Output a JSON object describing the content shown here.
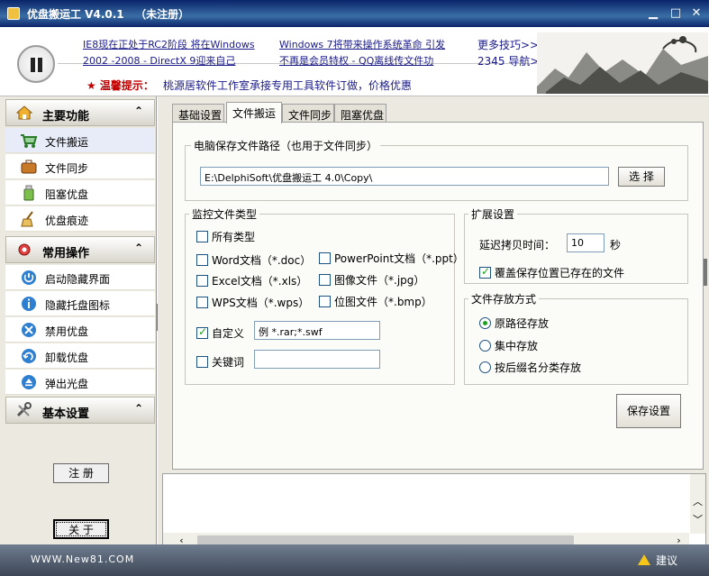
{
  "window": {
    "title": "优盘搬运工 V4.0.1   （未注册）",
    "min_glyph": "▁",
    "restore_glyph": "□",
    "close_glyph": "✕"
  },
  "banner": {
    "news": [
      "IE8现在正处于RC2阶段 将在Windows",
      "2002 -2008 - DirectX 9迎来自己",
      "Windows 7将带来操作系统革命 引发",
      "不再是会员特权 - QQ离线传文件功"
    ],
    "more_tips": "更多技巧>>",
    "nav_2345": "2345 导航>>",
    "tip_label": "★ 温馨提示：",
    "tip_text": "桃源居软件工作室承接专用工具软件订做，价格优惠"
  },
  "sidebar": {
    "sections": [
      {
        "label": "主要功能",
        "chevron": "⌃",
        "icon": "house-icon"
      },
      {
        "label": "常用操作",
        "chevron": "⌃",
        "icon": "gear-icon"
      },
      {
        "label": "基本设置",
        "chevron": "⌃",
        "icon": "tools-icon"
      }
    ],
    "main_items": [
      {
        "label": "文件搬运",
        "icon": "cart-icon"
      },
      {
        "label": "文件同步",
        "icon": "briefcase-icon"
      },
      {
        "label": "阻塞优盘",
        "icon": "usb-drive-icon"
      },
      {
        "label": "优盘痕迹",
        "icon": "broom-icon"
      }
    ],
    "ops_items": [
      {
        "label": "启动隐藏界面",
        "icon": "power-icon"
      },
      {
        "label": "隐藏托盘图标",
        "icon": "info-icon"
      },
      {
        "label": "禁用优盘",
        "icon": "block-icon"
      },
      {
        "label": "卸载优盘",
        "icon": "unload-icon"
      },
      {
        "label": "弹出光盘",
        "icon": "eject-icon"
      }
    ],
    "register_label": "注 册",
    "about_label": "关 于"
  },
  "tabs": [
    "基础设置",
    "文件搬运",
    "文件同步",
    "阻塞优盘"
  ],
  "path_group": {
    "legend": "电脑保存文件路径（也用于文件同步）",
    "path_value": "E:\\DelphiSoft\\优盘搬运工 4.0\\Copy\\",
    "browse_label": "选 择"
  },
  "types_group": {
    "legend": "监控文件类型",
    "all_types": "所有类型",
    "word": "Word文档（*.doc）",
    "excel": "Excel文档（*.xls）",
    "wps": "WPS文档（*.wps）",
    "ppt": "PowerPoint文档（*.ppt）",
    "image": "图像文件（*.jpg）",
    "bitmap": "位图文件（*.bmp）",
    "custom_label": "自定义",
    "custom_value": "例 *.rar;*.swf",
    "keyword_label": "关键词",
    "keyword_value": ""
  },
  "ext_group": {
    "legend": "扩展设置",
    "delay_label": "延迟拷贝时间：",
    "delay_value": "10",
    "delay_unit": "秒",
    "overwrite_label": "覆盖保存位置已存在的文件"
  },
  "store_group": {
    "legend": "文件存放方式",
    "options": [
      "原路径存放",
      "集中存放",
      "按后缀名分类存放"
    ]
  },
  "save_label": "保存设置",
  "status": {
    "site": "WWW.New81.COM",
    "suggest": "建议"
  },
  "colors": {
    "title_bar": "#0a246a",
    "link": "#1a1a8a",
    "tip_red": "#c00000",
    "check_green": "#21a121"
  }
}
